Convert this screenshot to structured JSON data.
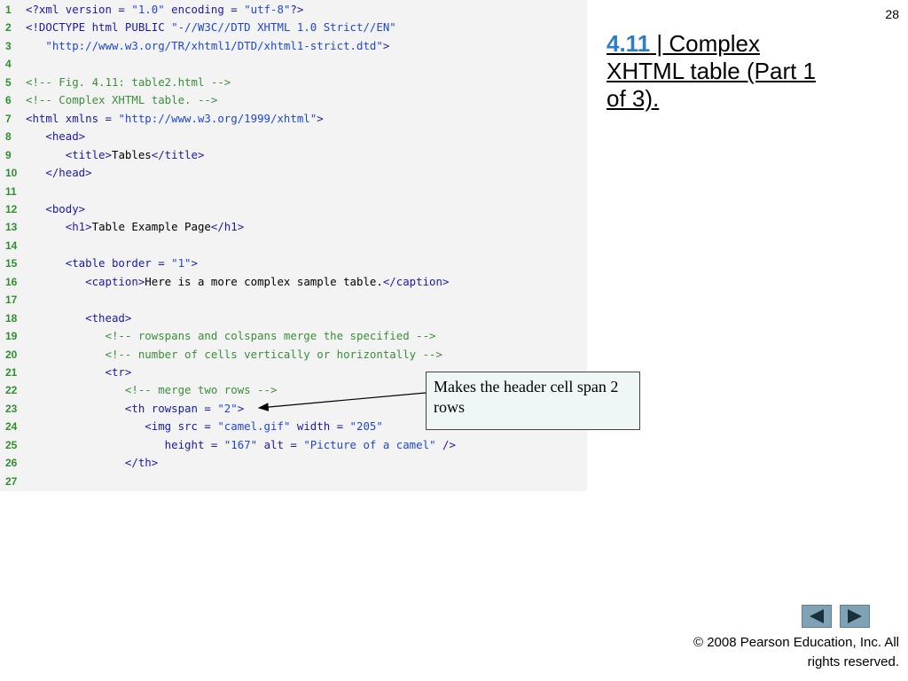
{
  "slide": {
    "number": "28",
    "title_fig": "4.11",
    "title_text": " | Complex XHTML table (Part 1 of 3).",
    "callout": "Makes the header cell span 2 rows",
    "copyright": "© 2008 Pearson Education, Inc.  All rights reserved.",
    "nav_prev": "previous-slide",
    "nav_next": "next-slide"
  },
  "code_lines": [
    {
      "n": "1",
      "tokens": [
        {
          "t": "tag",
          "s": "<?xml version = "
        },
        {
          "t": "str",
          "s": "\"1.0\""
        },
        {
          "t": "tag",
          "s": " encoding = "
        },
        {
          "t": "str",
          "s": "\"utf-8\""
        },
        {
          "t": "tag",
          "s": "?>"
        }
      ]
    },
    {
      "n": "2",
      "tokens": [
        {
          "t": "tag",
          "s": "<!DOCTYPE html PUBLIC "
        },
        {
          "t": "str",
          "s": "\"-//W3C//DTD XHTML 1.0 Strict//EN\""
        }
      ]
    },
    {
      "n": "3",
      "tokens": [
        {
          "t": "str",
          "s": "   \"http://www.w3.org/TR/xhtml1/DTD/xhtml1-strict.dtd\""
        },
        {
          "t": "tag",
          "s": ">"
        }
      ]
    },
    {
      "n": "4",
      "tokens": []
    },
    {
      "n": "5",
      "tokens": [
        {
          "t": "cmt",
          "s": "<!-- Fig. 4.11: table2.html -->"
        }
      ]
    },
    {
      "n": "6",
      "tokens": [
        {
          "t": "cmt",
          "s": "<!-- Complex XHTML table. -->"
        }
      ]
    },
    {
      "n": "7",
      "tokens": [
        {
          "t": "tag",
          "s": "<html xmlns = "
        },
        {
          "t": "str",
          "s": "\"http://www.w3.org/1999/xhtml\""
        },
        {
          "t": "tag",
          "s": ">"
        }
      ]
    },
    {
      "n": "8",
      "tokens": [
        {
          "t": "tag",
          "s": "   <head>"
        }
      ]
    },
    {
      "n": "9",
      "tokens": [
        {
          "t": "tag",
          "s": "      <title>"
        },
        {
          "t": "txt",
          "s": "Tables"
        },
        {
          "t": "tag",
          "s": "</title>"
        }
      ]
    },
    {
      "n": "10",
      "tokens": [
        {
          "t": "tag",
          "s": "   </head>"
        }
      ]
    },
    {
      "n": "11",
      "tokens": []
    },
    {
      "n": "12",
      "tokens": [
        {
          "t": "tag",
          "s": "   <body>"
        }
      ]
    },
    {
      "n": "13",
      "tokens": [
        {
          "t": "tag",
          "s": "      <h1>"
        },
        {
          "t": "txt",
          "s": "Table Example Page"
        },
        {
          "t": "tag",
          "s": "</h1>"
        }
      ]
    },
    {
      "n": "14",
      "tokens": []
    },
    {
      "n": "15",
      "tokens": [
        {
          "t": "tag",
          "s": "      <table border = "
        },
        {
          "t": "str",
          "s": "\"1\""
        },
        {
          "t": "tag",
          "s": ">"
        }
      ]
    },
    {
      "n": "16",
      "tokens": [
        {
          "t": "tag",
          "s": "         <caption>"
        },
        {
          "t": "txt",
          "s": "Here is a more complex sample table."
        },
        {
          "t": "tag",
          "s": "</caption>"
        }
      ]
    },
    {
      "n": "17",
      "tokens": []
    },
    {
      "n": "18",
      "tokens": [
        {
          "t": "tag",
          "s": "         <thead>"
        }
      ]
    },
    {
      "n": "19",
      "tokens": [
        {
          "t": "cmt",
          "s": "            <!-- rowspans and colspans merge the specified -->"
        }
      ]
    },
    {
      "n": "20",
      "tokens": [
        {
          "t": "cmt",
          "s": "            <!-- number of cells vertically or horizontally -->"
        }
      ]
    },
    {
      "n": "21",
      "tokens": [
        {
          "t": "tag",
          "s": "            <tr>"
        }
      ]
    },
    {
      "n": "22",
      "tokens": [
        {
          "t": "cmt",
          "s": "               <!-- merge two rows -->"
        }
      ]
    },
    {
      "n": "23",
      "tokens": [
        {
          "t": "tag",
          "s": "               <th rowspan = "
        },
        {
          "t": "str",
          "s": "\"2\""
        },
        {
          "t": "tag",
          "s": ">"
        }
      ]
    },
    {
      "n": "24",
      "tokens": [
        {
          "t": "tag",
          "s": "                  <img src = "
        },
        {
          "t": "str",
          "s": "\"camel.gif\""
        },
        {
          "t": "tag",
          "s": " width = "
        },
        {
          "t": "str",
          "s": "\"205\""
        }
      ]
    },
    {
      "n": "25",
      "tokens": [
        {
          "t": "tag",
          "s": "                     height = "
        },
        {
          "t": "str",
          "s": "\"167\""
        },
        {
          "t": "tag",
          "s": " alt = "
        },
        {
          "t": "str",
          "s": "\"Picture of a camel\""
        },
        {
          "t": "tag",
          "s": " />"
        }
      ]
    },
    {
      "n": "26",
      "tokens": [
        {
          "t": "tag",
          "s": "               </th>"
        }
      ]
    },
    {
      "n": "27",
      "tokens": []
    }
  ]
}
